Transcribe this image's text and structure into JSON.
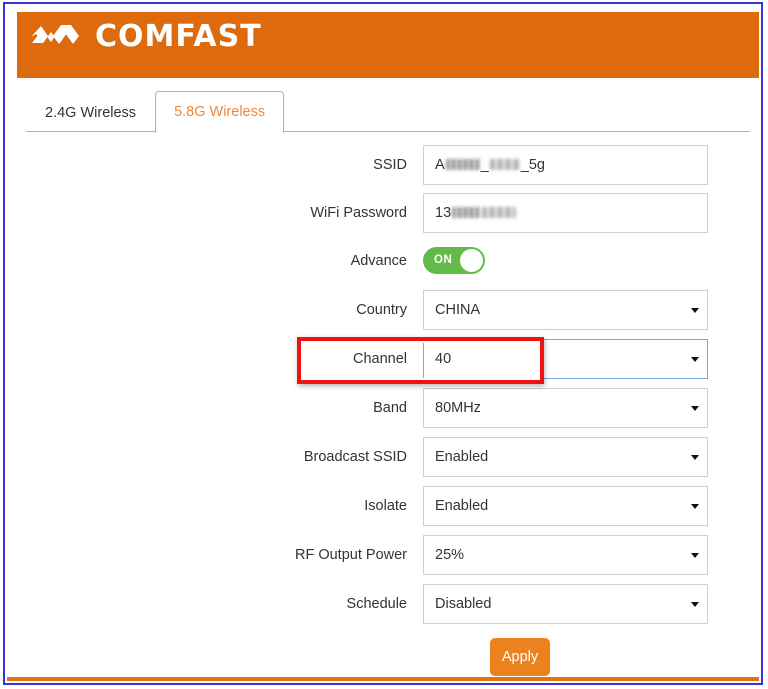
{
  "brand": {
    "name": "COMFAST",
    "logo_icon": "comfast-chevron-logo",
    "header_color": "#dd6a0d"
  },
  "tabs": [
    {
      "label": "2.4G Wireless",
      "active": false
    },
    {
      "label": "5.8G Wireless",
      "active": true
    }
  ],
  "form": {
    "ssid": {
      "label": "SSID",
      "value_prefix": "A",
      "value_middle": "_",
      "value_suffix": "_5g",
      "value": "A███_███_5g",
      "redacted": true
    },
    "wifi_password": {
      "label": "WiFi Password",
      "value_prefix": "13",
      "value": "13████ ████",
      "redacted": true
    },
    "advance": {
      "label": "Advance",
      "state": "ON",
      "on": true,
      "on_color": "#62bb46"
    },
    "country": {
      "label": "Country",
      "value": "CHINA"
    },
    "channel": {
      "label": "Channel",
      "value": "40",
      "focused": true,
      "highlighted": true
    },
    "band": {
      "label": "Band",
      "value": "80MHz"
    },
    "broadcast_ssid": {
      "label": "Broadcast SSID",
      "value": "Enabled"
    },
    "isolate": {
      "label": "Isolate",
      "value": "Enabled"
    },
    "rf_output_power": {
      "label": "RF Output Power",
      "value": "25%"
    },
    "schedule": {
      "label": "Schedule",
      "value": "Disabled"
    }
  },
  "actions": {
    "apply_label": "Apply",
    "apply_color": "#ec8120"
  },
  "annotation": {
    "type": "red-rectangle-highlight",
    "target": "Channel",
    "color": "#f01111"
  }
}
